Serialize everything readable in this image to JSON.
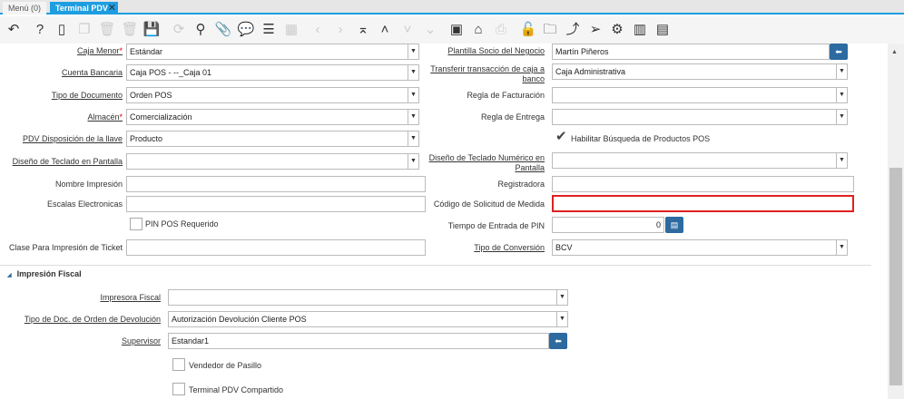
{
  "tabs": {
    "menu": "Menú (0)",
    "active": "Terminal PDV"
  },
  "toolbar_icons": [
    "undo-icon",
    "help-icon",
    "new-icon",
    "copy-icon",
    "delete-icon",
    "delete-selection-icon",
    "save-icon",
    "refresh-icon",
    "search-icon",
    "attachment-icon",
    "chat-icon",
    "grid-toggle-icon",
    "calendar-icon",
    "previous-icon",
    "next-icon",
    "first-record-icon",
    "parent-record-icon",
    "detail-record-icon",
    "last-record-icon",
    "report-icon",
    "archive-icon",
    "print-icon",
    "lock-icon",
    "zoom-across-icon",
    "workflow-icon",
    "send-icon",
    "process-icon",
    "barcode-icon",
    "info-icon"
  ],
  "fields": {
    "caja_menor": {
      "label": "Caja Menor",
      "value": "Estándar"
    },
    "cuenta_bancaria": {
      "label": "Cuenta Bancaria",
      "value": "Caja POS - --_Caja 01"
    },
    "tipo_documento": {
      "label": "Tipo de Documento",
      "value": "Orden POS"
    },
    "almacen": {
      "label": "Almacén",
      "value": "Comercialización"
    },
    "pdv_disposicion": {
      "label": "PDV Disposición de la llave",
      "value": "Producto"
    },
    "diseno_teclado": {
      "label": "Diseño de Teclado en Pantalla",
      "value": ""
    },
    "nombre_impresion": {
      "label": "Nombre Impresión",
      "value": ""
    },
    "escalas": {
      "label": "Escalas Electronicas",
      "value": ""
    },
    "pin_pos": {
      "label": "PIN POS Requerido"
    },
    "clase_ticket": {
      "label": "Clase Para Impresión de Ticket",
      "value": ""
    },
    "plantilla_socio": {
      "label": "Plantilla Socio del Negocio",
      "value": "Martín Piñeros"
    },
    "transferir": {
      "label": "Transferir transacción de caja a banco",
      "value": "Caja Administrativa"
    },
    "regla_facturacion": {
      "label": "Regla de Facturación",
      "value": ""
    },
    "regla_entrega": {
      "label": "Regla de Entrega",
      "value": ""
    },
    "habilitar_busqueda": {
      "label": "Habilitar Búsqueda de Productos POS",
      "checked": true
    },
    "diseno_numerico": {
      "label": "Diseño de Teclado Numérico en Pantalla",
      "value": ""
    },
    "registradora": {
      "label": "Registradora",
      "value": ""
    },
    "codigo_solicitud": {
      "label": "Código de Solicitud de Medida",
      "value": ""
    },
    "tiempo_pin": {
      "label": "Tiempo de Entrada de PIN",
      "value": "0"
    },
    "tipo_conversion": {
      "label": "Tipo de Conversión",
      "value": "BCV"
    }
  },
  "fiscal": {
    "title": "Impresión Fiscal",
    "impresora": {
      "label": "Impresora Fiscal",
      "value": ""
    },
    "tipo_doc_devolucion": {
      "label": "Tipo de Doc. de Orden de Devolución",
      "value": "Autorización Devolución Cliente POS"
    },
    "supervisor": {
      "label": "Supervisor",
      "value": "Estandar1"
    },
    "vendedor_pasillo": {
      "label": "Vendedor de Pasillo"
    },
    "terminal_compartido": {
      "label": "Terminal PDV Compartido"
    }
  }
}
